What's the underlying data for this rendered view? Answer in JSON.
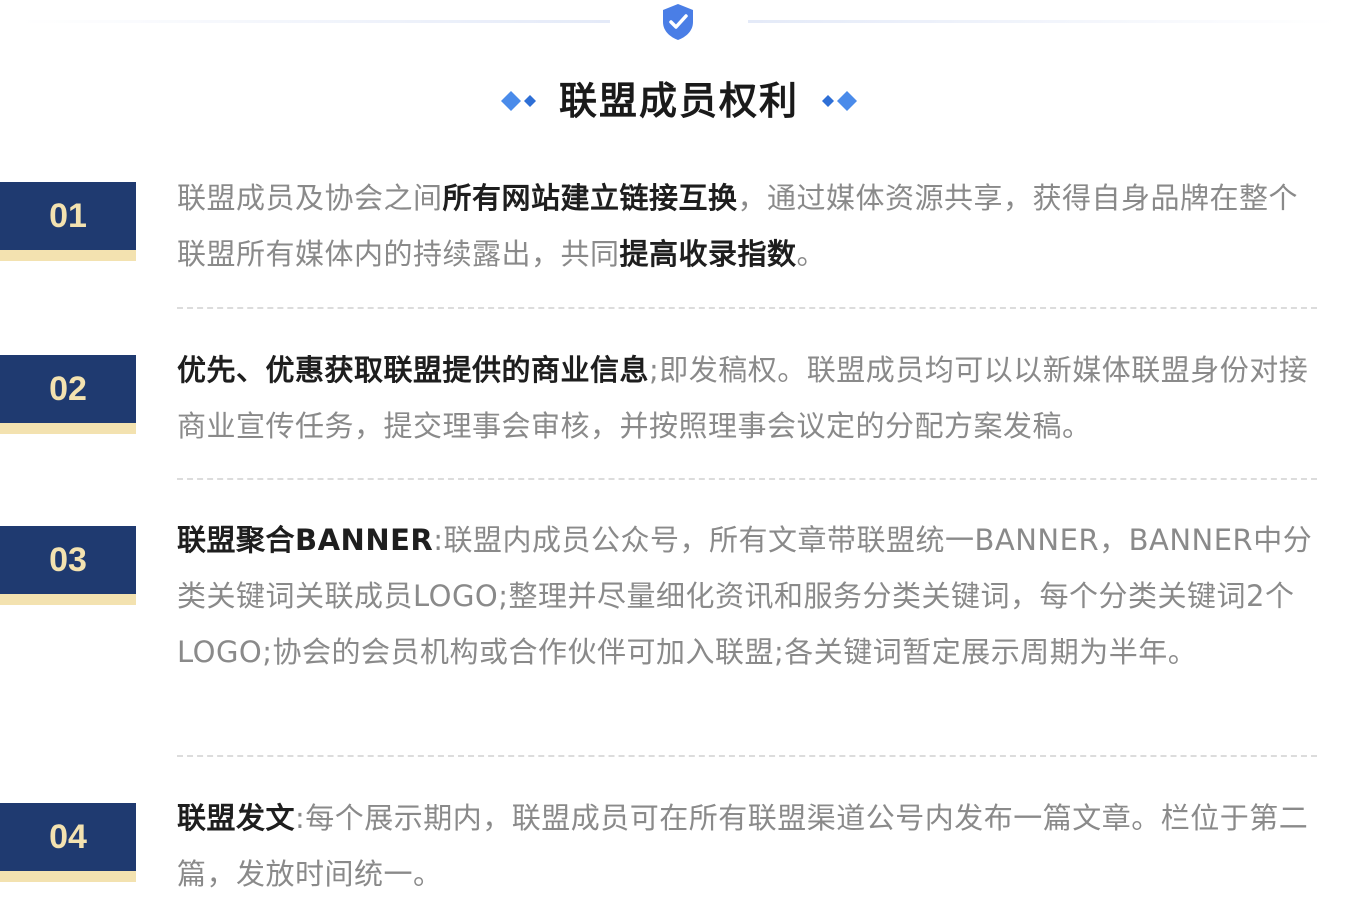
{
  "header": {
    "title": "联盟成员权利",
    "shield_icon": "shield-check-icon",
    "accent_color": "#4a7ee6"
  },
  "items": [
    {
      "number": "01",
      "segments": [
        {
          "t": "联盟成员及协会之间",
          "bold": false
        },
        {
          "t": "所有网站建立链接互换",
          "bold": true
        },
        {
          "t": "，通过媒体资源共享，获得自身品牌在整个联盟所有媒体内的持续露出，共同",
          "bold": false
        },
        {
          "t": "提高收录指数",
          "bold": true
        },
        {
          "t": "。",
          "bold": false
        }
      ]
    },
    {
      "number": "02",
      "segments": [
        {
          "t": "优先、优惠获取联盟提供的商业信息",
          "bold": true
        },
        {
          "t": ";即发稿权。联盟成员均可以以新媒体联盟身份对接商业宣传任务，提交理事会审核，并按照理事会议定的分配方案发稿。",
          "bold": false
        }
      ]
    },
    {
      "number": "03",
      "segments": [
        {
          "t": "联盟聚合BANNER",
          "bold": true
        },
        {
          "t": ":联盟内成员公众号，所有文章带联盟统一BANNER，BANNER中分类关键词关联成员LOGO;整理并尽量细化资讯和服务分类关键词，每个分类关键词2个LOGO;协会的会员机构或合作伙伴可加入联盟;各关键词暂定展示周期为半年。",
          "bold": false
        }
      ]
    },
    {
      "number": "04",
      "segments": [
        {
          "t": "联盟发文",
          "bold": true
        },
        {
          "t": ":每个展示期内，联盟成员可在所有联盟渠道公号内发布一篇文章。栏位于第二篇，发放时间统一。",
          "bold": false
        }
      ]
    }
  ],
  "colors": {
    "badge_blue": "#1f3a70",
    "badge_gold": "#f3e2b0",
    "text_gray": "#8a8a8a",
    "text_dark": "#1e1e1e"
  }
}
